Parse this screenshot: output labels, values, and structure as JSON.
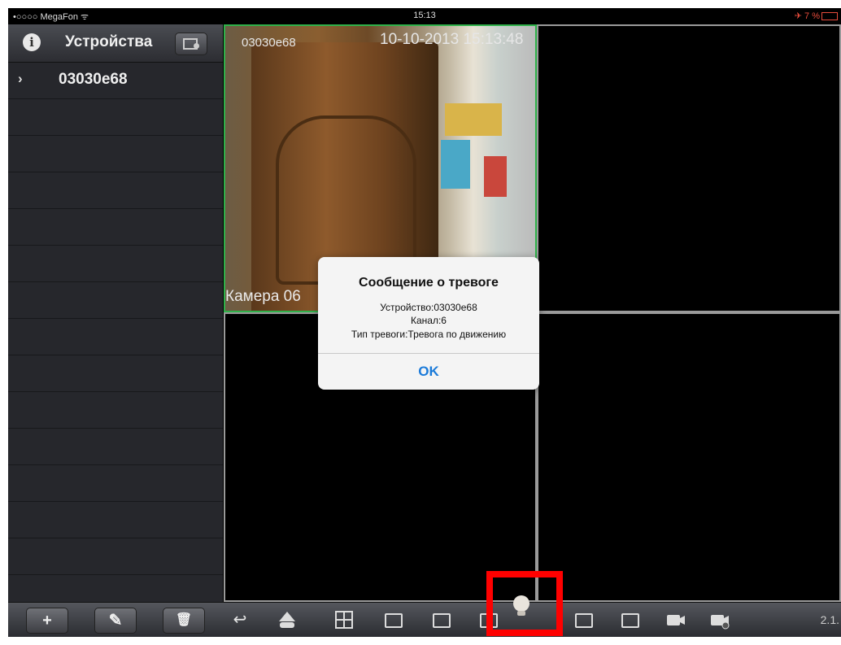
{
  "status_bar": {
    "carrier": "•○○○○ MegaFon ᯤ",
    "time": "15:13",
    "battery": "✈ 7 %"
  },
  "sidebar": {
    "title": "Устройства",
    "devices": [
      {
        "name": "03030e68"
      }
    ]
  },
  "cameras": [
    {
      "label": "03030e68",
      "timestamp": "10-10-2013 15:13:48",
      "name": "Камера 06"
    },
    {
      "label": "",
      "timestamp": "",
      "name": ""
    },
    {
      "label": "",
      "timestamp": "",
      "name": ""
    },
    {
      "label": "",
      "timestamp": "",
      "name": ""
    }
  ],
  "alert": {
    "title": "Сообщение о тревоге",
    "device_line": "Устройство:03030e68",
    "channel_line": "Канал:6",
    "type_line": "Тип тревоги:Тревога по движению",
    "ok_label": "OK"
  },
  "toolbar": {
    "add": "+",
    "edit": "✎",
    "delete": "🗑",
    "back": "↩",
    "version": "2.1."
  },
  "colors": {
    "highlight": "#ff0000",
    "selected_cell": "#2fb14a",
    "ok_text": "#1a7ad9"
  }
}
